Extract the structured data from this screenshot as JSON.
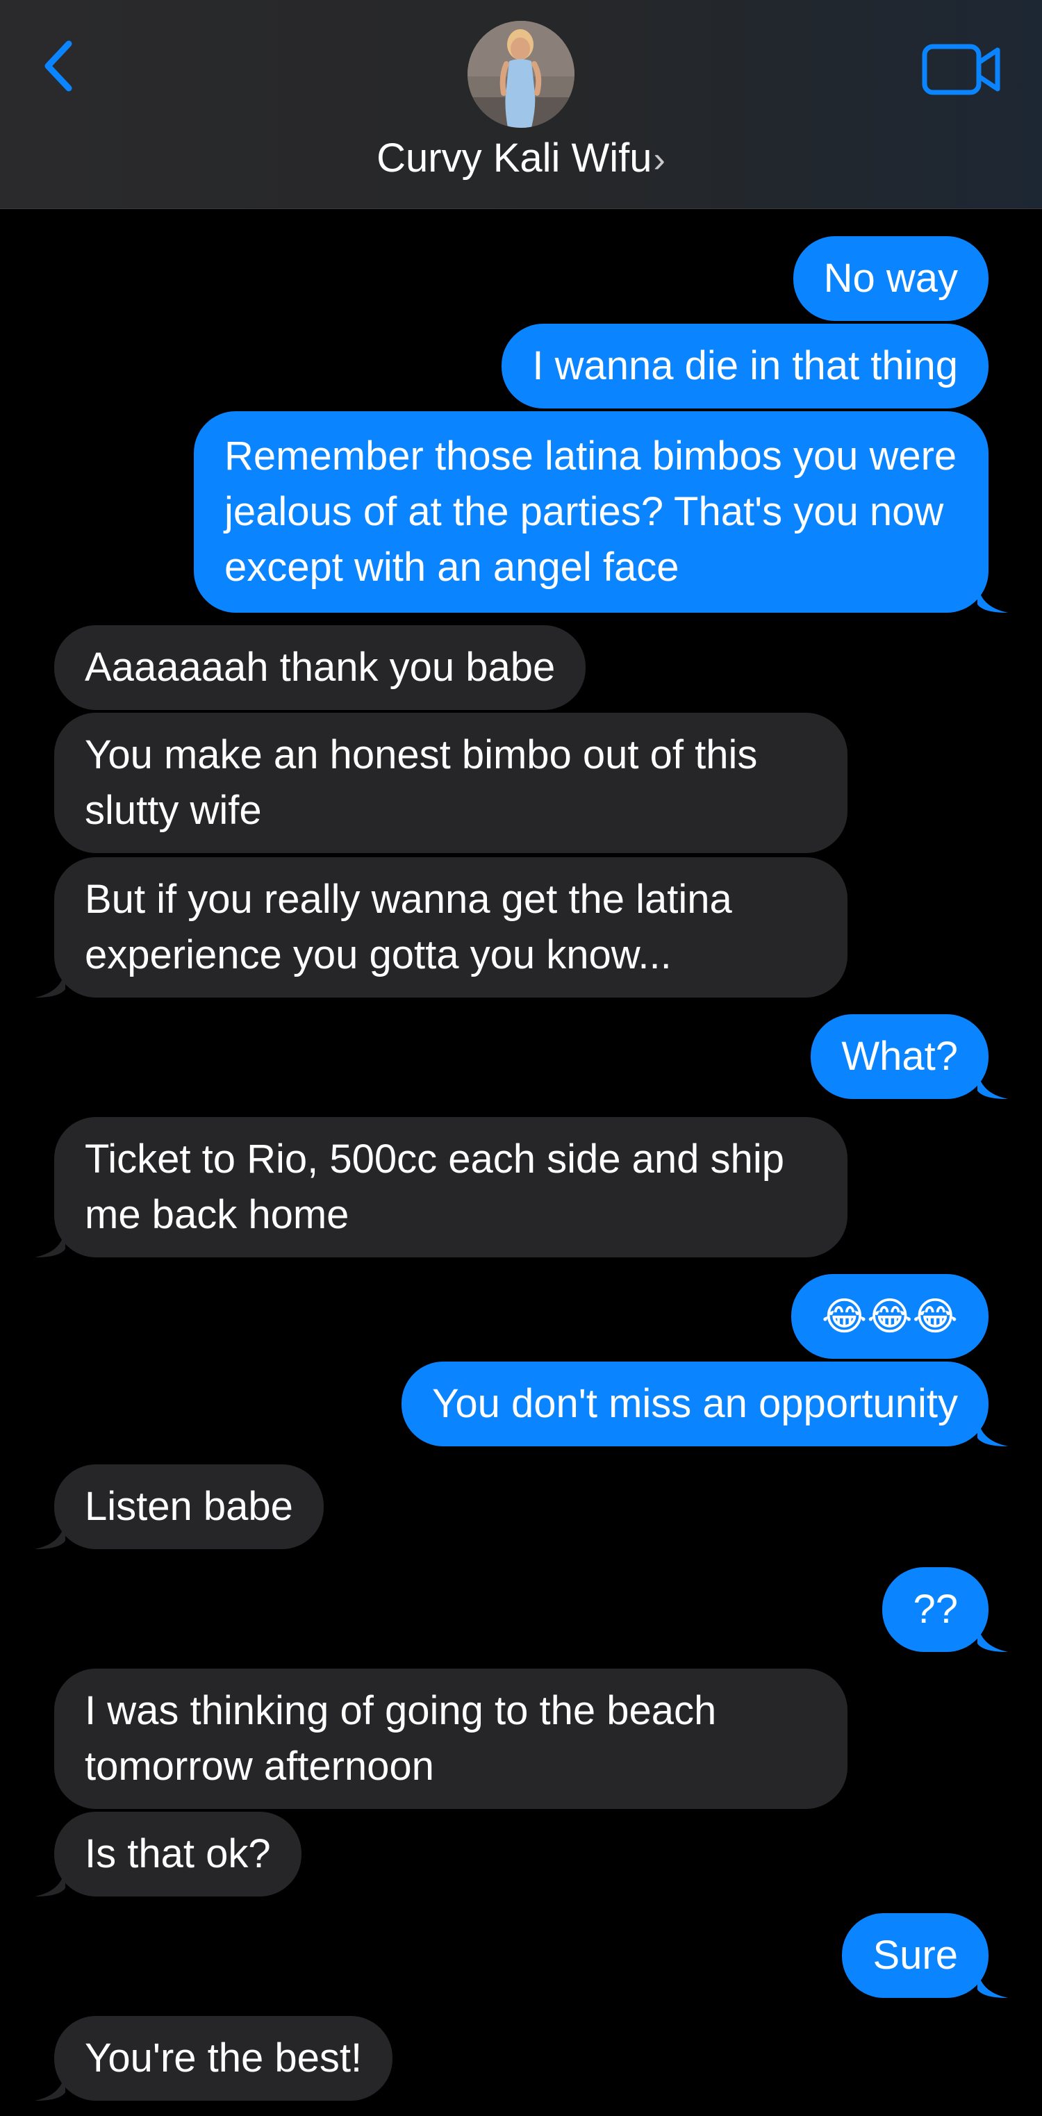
{
  "header": {
    "contact_name": "Curvy Kali Wifu",
    "chevron": "›",
    "back_icon": "chevron-left-icon",
    "video_icon": "video-camera-icon",
    "accent_color": "#0a84ff"
  },
  "messages": [
    {
      "dir": "out",
      "text": "No way"
    },
    {
      "dir": "out",
      "text": "I wanna die in that thing"
    },
    {
      "dir": "out",
      "text": "Remember those latina bimbos you were jealous of at the parties? That's you now except with an angel face"
    },
    {
      "dir": "in",
      "text": "Aaaaaaah thank you babe"
    },
    {
      "dir": "in",
      "text": "You make an honest bimbo out of this slutty wife"
    },
    {
      "dir": "in",
      "text": "But if you really wanna get the latina experience you gotta you know..."
    },
    {
      "dir": "out",
      "text": "What?"
    },
    {
      "dir": "in",
      "text": "Ticket to Rio, 500cc each side and ship me back home"
    },
    {
      "dir": "out",
      "text": "😂😂😂"
    },
    {
      "dir": "out",
      "text": "You don't miss an opportunity"
    },
    {
      "dir": "in",
      "text": "Listen babe"
    },
    {
      "dir": "out",
      "text": "??"
    },
    {
      "dir": "in",
      "text": "I was thinking of going to the beach tomorrow afternoon"
    },
    {
      "dir": "in",
      "text": "Is that ok?"
    },
    {
      "dir": "out",
      "text": "Sure"
    },
    {
      "dir": "in",
      "text": "You're the best!"
    }
  ]
}
